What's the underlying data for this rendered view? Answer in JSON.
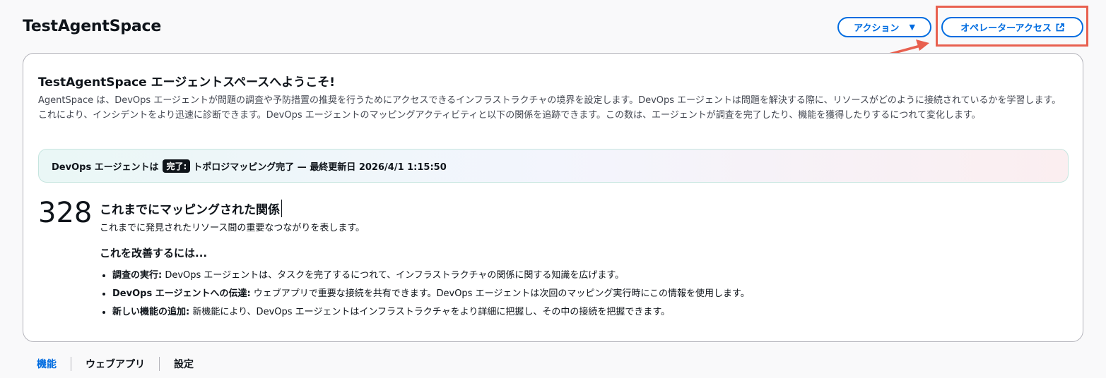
{
  "header": {
    "title": "TestAgentSpace",
    "actions_label": "アクション",
    "operator_access_label": "オペレーターアクセス"
  },
  "card": {
    "title": "TestAgentSpace エージェントスペースへようこそ!",
    "description": "AgentSpace は、DevOps エージェントが問題の調査や予防措置の推奨を行うためにアクセスできるインフラストラクチャの境界を設定します。DevOps エージェントは問題を解決する際に、リソースがどのように接続されているかを学習します。これにより、インシデントをより迅速に診断できます。DevOps エージェントのマッピングアクティビティと以下の関係を追跡できます。この数は、エージェントが調査を完了したり、機能を獲得したりするにつれて変化します。",
    "status": {
      "prefix": "DevOps エージェントは",
      "badge": "完了:",
      "text": "トポロジマッピング完了 — 最終更新日 2026/4/1 1:15:50"
    },
    "metric": {
      "value": "328",
      "title": "これまでにマッピングされた関係",
      "subtitle": "これまでに発見されたリソース間の重要なつながりを表します。"
    },
    "improve": {
      "heading": "これを改善するには...",
      "items": [
        {
          "label": "調査の実行:",
          "text": " DevOps エージェントは、タスクを完了するにつれて、インフラストラクチャの関係に関する知識を広げます。"
        },
        {
          "label": "DevOps エージェントへの伝達:",
          "text": " ウェブアプリで重要な接続を共有できます。DevOps エージェントは次回のマッピング実行時にこの情報を使用します。"
        },
        {
          "label": "新しい機能の追加:",
          "text": " 新機能により、DevOps エージェントはインフラストラクチャをより詳細に把握し、その中の接続を把握できます。"
        }
      ]
    }
  },
  "tabs": [
    {
      "label": "機能"
    },
    {
      "label": "ウェブアプリ"
    },
    {
      "label": "設定"
    }
  ],
  "colors": {
    "accent": "#006ce0",
    "annotation": "#e8604f"
  }
}
